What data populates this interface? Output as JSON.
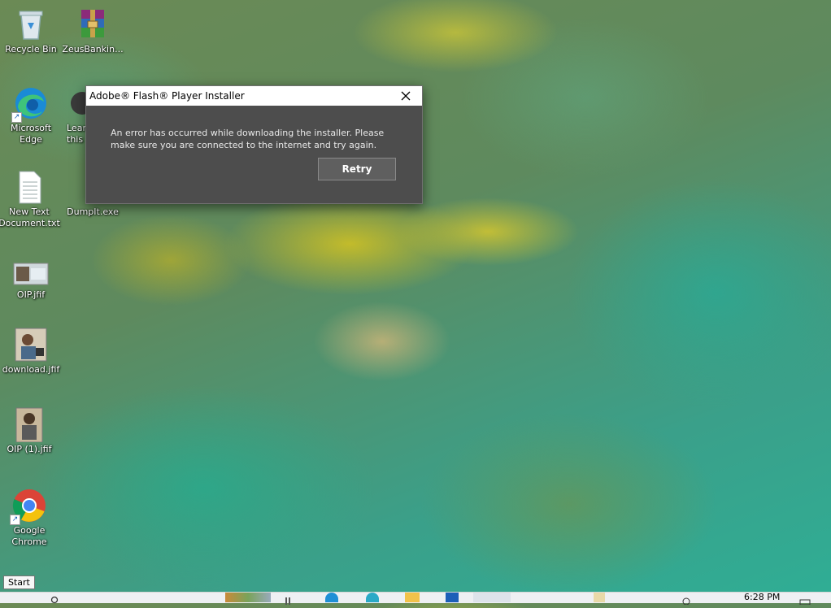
{
  "desktop": {
    "icons": [
      {
        "label": "Recycle Bin",
        "icon": "recycle-bin-icon"
      },
      {
        "label": "ZeusBankin...",
        "icon": "winrar-archive-icon"
      },
      {
        "label": "Microsoft Edge",
        "icon": "edge-icon"
      },
      {
        "label": "Lear this",
        "icon": "app-icon"
      },
      {
        "label": "New Text Document.txt",
        "icon": "text-file-icon"
      },
      {
        "label": "DumpIt.exe",
        "icon": "exe-icon"
      },
      {
        "label": "OIP.jfif",
        "icon": "image-file-icon"
      },
      {
        "label": "download.jfif",
        "icon": "image-file-icon"
      },
      {
        "label": "OIP (1).jfif",
        "icon": "image-file-icon"
      },
      {
        "label": "Google Chrome",
        "icon": "chrome-icon"
      }
    ]
  },
  "dialog": {
    "title": "Adobe® Flash® Player Installer",
    "message": "An error has occurred while downloading the installer. Please make sure you are connected to the internet and try again.",
    "retry_label": "Retry"
  },
  "taskbar": {
    "start_tooltip": "Start",
    "clock": "6:28 PM"
  },
  "colors": {
    "dialog_bg": "#4d4d4d",
    "titlebar_bg": "#ffffff",
    "button_bg": "#5f5f5f"
  }
}
